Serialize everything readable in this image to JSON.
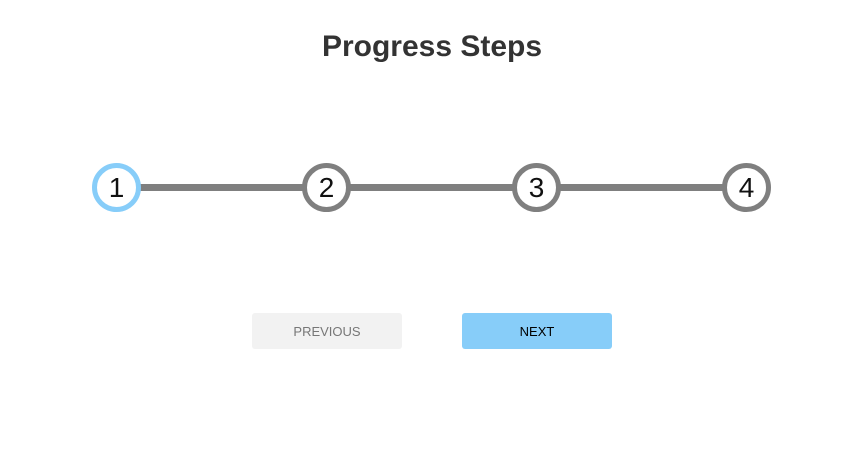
{
  "page": {
    "title": "Progress Steps"
  },
  "progress": {
    "active_step": 1,
    "completed_fraction": 0,
    "steps": [
      {
        "label": "1",
        "state": "active"
      },
      {
        "label": "2",
        "state": "inactive"
      },
      {
        "label": "3",
        "state": "inactive"
      },
      {
        "label": "4",
        "state": "inactive"
      }
    ]
  },
  "buttons": {
    "previous_label": "PREVIOUS",
    "previous_disabled": true,
    "next_label": "NEXT"
  },
  "colors": {
    "accent": "#87cdf9",
    "inactive": "#7f7f7f",
    "disabled_button_bg": "#f2f2f2",
    "title": "#333333"
  }
}
